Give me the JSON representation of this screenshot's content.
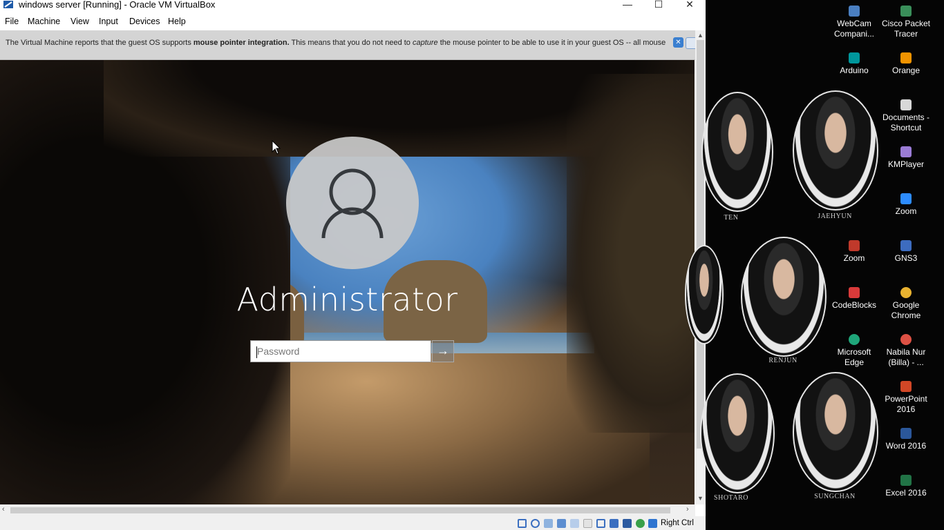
{
  "window": {
    "title": "windows server [Running] - Oracle VM VirtualBox",
    "minimize": "—",
    "maximize": "☐",
    "close": "✕"
  },
  "menu": [
    "File",
    "Machine",
    "View",
    "Input",
    "Devices",
    "Help"
  ],
  "infobar": {
    "text_1": "The Virtual Machine reports that the guest OS supports ",
    "bold": "mouse pointer integration.",
    "text_2": " This means that you do not need to ",
    "italic": "capture",
    "text_3": " the mouse pointer to be able to use it in your guest OS -- all mouse"
  },
  "login": {
    "username": "Administrator",
    "password_placeholder": "Password",
    "submit_glyph": "→"
  },
  "statusbar": {
    "host_key": "Right Ctrl"
  },
  "desktop": {
    "photo_labels": [
      "TEN",
      "JAEHYUN",
      "RENJUN",
      "SHOTARO",
      "SUNGCHAN"
    ],
    "icons": [
      {
        "label": "WebCam Compani...",
        "icon": "webcam-icon",
        "color": "#4a7fc1"
      },
      {
        "label": "Cisco Packet Tracer",
        "icon": "packet-tracer-icon",
        "color": "#3a8f5a"
      },
      {
        "label": "Arduino",
        "icon": "arduino-icon",
        "color": "#00979c"
      },
      {
        "label": "Orange",
        "icon": "orange-icon",
        "color": "#f29400"
      },
      {
        "label": "Documents - Shortcut",
        "icon": "documents-icon",
        "color": "#d8d8d8"
      },
      {
        "label": "KMPlayer",
        "icon": "kmplayer-icon",
        "color": "#9b7cd6"
      },
      {
        "label": "Zoom",
        "icon": "zoom-icon",
        "color": "#2d8cff"
      },
      {
        "label": "Zoom",
        "icon": "zoom-icon",
        "color": "#c0392b"
      },
      {
        "label": "GNS3",
        "icon": "gns3-icon",
        "color": "#3d6cc0"
      },
      {
        "label": "CodeBlocks",
        "icon": "codeblocks-icon",
        "color": "#d93a3a"
      },
      {
        "label": "Google Chrome",
        "icon": "chrome-icon",
        "color": "#e8b230"
      },
      {
        "label": "Microsoft Edge",
        "icon": "edge-icon",
        "color": "#1fa67a"
      },
      {
        "label": "Nabila Nur (Billa) - ...",
        "icon": "chrome-profile-icon",
        "color": "#dd5144"
      },
      {
        "label": "PowerPoint 2016",
        "icon": "powerpoint-icon",
        "color": "#d24726"
      },
      {
        "label": "Word 2016",
        "icon": "word-icon",
        "color": "#2b579a"
      },
      {
        "label": "Excel 2016",
        "icon": "excel-icon",
        "color": "#217346"
      }
    ]
  }
}
